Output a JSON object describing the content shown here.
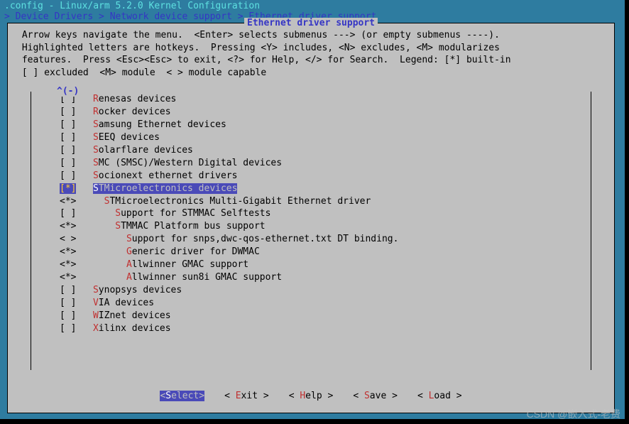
{
  "header": {
    "line1": ".config - Linux/arm 5.2.0 Kernel Configuration",
    "line2": " > Device Drivers > Network device support > Ethernet driver support"
  },
  "box_title": "Ethernet driver support",
  "help_text": " Arrow keys navigate the menu.  <Enter> selects submenus ---> (or empty submenus ----).\n Highlighted letters are hotkeys.  Pressing <Y> includes, <N> excludes, <M> modularizes\n features.  Press <Esc><Esc> to exit, <?> for Help, </> for Search.  Legend: [*] built-in\n [ ] excluded  <M> module  < > module capable",
  "scroll_indicator": "^(-)",
  "menu": [
    {
      "bracket": "[ ]",
      "indent": 0,
      "hotkey": "R",
      "rest": "enesas devices"
    },
    {
      "bracket": "[ ]",
      "indent": 0,
      "hotkey": "R",
      "rest": "ocker devices"
    },
    {
      "bracket": "[ ]",
      "indent": 0,
      "hotkey": "S",
      "rest": "amsung Ethernet devices"
    },
    {
      "bracket": "[ ]",
      "indent": 0,
      "hotkey": "S",
      "rest": "EEQ devices"
    },
    {
      "bracket": "[ ]",
      "indent": 0,
      "hotkey": "S",
      "rest": "olarflare devices"
    },
    {
      "bracket": "[ ]",
      "indent": 0,
      "hotkey": "S",
      "rest": "MC (SMSC)/Western Digital devices"
    },
    {
      "bracket": "[ ]",
      "indent": 0,
      "hotkey": "S",
      "rest": "ocionext ethernet drivers"
    },
    {
      "bracket": "[*]",
      "indent": 0,
      "hotkey": "S",
      "rest": "TMicroelectronics devices",
      "selected": true
    },
    {
      "bracket": "<*>",
      "indent": 1,
      "hotkey": "S",
      "rest": "TMicroelectronics Multi-Gigabit Ethernet driver"
    },
    {
      "bracket": "[ ]",
      "indent": 2,
      "hotkey": "S",
      "rest": "upport for STMMAC Selftests"
    },
    {
      "bracket": "<*>",
      "indent": 2,
      "hotkey": "S",
      "rest": "TMMAC Platform bus support"
    },
    {
      "bracket": "< >",
      "indent": 3,
      "hotkey": "S",
      "rest": "upport for snps,dwc-qos-ethernet.txt DT binding."
    },
    {
      "bracket": "<*>",
      "indent": 3,
      "hotkey": "G",
      "rest": "eneric driver for DWMAC"
    },
    {
      "bracket": "<*>",
      "indent": 3,
      "hotkey": "A",
      "rest": "llwinner GMAC support"
    },
    {
      "bracket": "<*>",
      "indent": 3,
      "hotkey": "A",
      "rest": "llwinner sun8i GMAC support"
    },
    {
      "bracket": "[ ]",
      "indent": 0,
      "hotkey": "S",
      "rest": "ynopsys devices"
    },
    {
      "bracket": "[ ]",
      "indent": 0,
      "hotkey": "V",
      "rest": "IA devices"
    },
    {
      "bracket": "[ ]",
      "indent": 0,
      "hotkey": "W",
      "rest": "IZnet devices"
    },
    {
      "bracket": "[ ]",
      "indent": 0,
      "hotkey": "X",
      "rest": "ilinx devices"
    }
  ],
  "buttons": [
    {
      "hotkey": "S",
      "rest": "elect",
      "selected": true
    },
    {
      "hotkey": "E",
      "rest": "xit"
    },
    {
      "hotkey": "H",
      "rest": "elp"
    },
    {
      "hotkey": "S",
      "rest": "ave"
    },
    {
      "hotkey": "L",
      "rest": "oad"
    }
  ],
  "watermark": "CSDN @嵌入式-老费"
}
